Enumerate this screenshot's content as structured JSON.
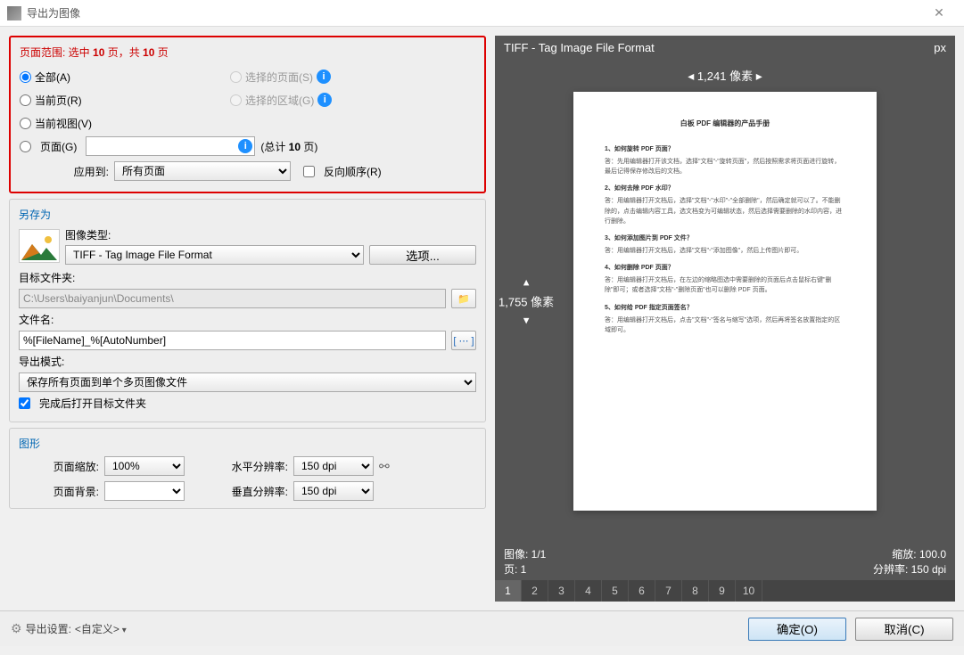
{
  "window": {
    "title": "导出为图像"
  },
  "pageRange": {
    "title_prefix": "页面范围: 选中 ",
    "selected": "10",
    "title_mid": " 页，共 ",
    "total": "10",
    "title_suffix": " 页",
    "all": "全部(A)",
    "current": "当前页(R)",
    "currentView": "当前视图(V)",
    "pages": "页面(G)",
    "selectedPages": "选择的页面(S)",
    "selectedArea": "选择的区域(G)",
    "totalLabel_prefix": "(总计 ",
    "totalLabel_count": "10",
    "totalLabel_suffix": " 页)",
    "applyTo": "应用到:",
    "applyToValue": "所有页面",
    "reverse": "反向顺序(R)"
  },
  "saveAs": {
    "title": "另存为",
    "imageType": "图像类型:",
    "imageTypeValue": "TIFF - Tag Image File Format",
    "options": "选项...",
    "targetFolder": "目标文件夹:",
    "targetFolderValue": "C:\\Users\\baiyanjun\\Documents\\",
    "fileName": "文件名:",
    "fileNameValue": "%[FileName]_%[AutoNumber]",
    "exportMode": "导出模式:",
    "exportModeValue": "保存所有页面到单个多页图像文件",
    "openAfter": "完成后打开目标文件夹"
  },
  "graphics": {
    "title": "图形",
    "pageZoom": "页面缩放:",
    "pageZoomValue": "100%",
    "pageBg": "页面背景:",
    "hRes": "水平分辨率:",
    "hResValue": "150 dpi",
    "vRes": "垂直分辨率:",
    "vResValue": "150 dpi"
  },
  "preview": {
    "format": "TIFF - Tag Image File Format",
    "unit": "px",
    "width": "1,241 像素",
    "height": "1,755 像素",
    "imageIdx": "图像: 1/1",
    "pageIdx": "页: 1",
    "zoom": "缩放: 100.0",
    "res": "分辨率: 150 dpi",
    "tabs": [
      "1",
      "2",
      "3",
      "4",
      "5",
      "6",
      "7",
      "8",
      "9",
      "10"
    ],
    "doc": {
      "title": "白板 PDF 编辑器的产品手册",
      "q1": "1、如何旋转 PDF 页面？",
      "a1": "答：先用编辑器打开该文档，选择\"文档\"-\"旋转页面\"，然后按照需求将页面进行旋转，最后记得保存修改后的文档。",
      "q2": "2、如何去除 PDF 水印？",
      "a2": "答：用编辑器打开文档后，选择\"文档\"-\"水印\"-\"全部删除\"，然后确定就可以了。不能删除的，点击编辑内容工具，选文档变为可编辑状态，然后选择需要删除的水印内容，进行删除。",
      "q3": "3、如何添加图片到 PDF 文件？",
      "a3": "答：用编辑器打开文档后，选择\"文档\"-\"添加图像\"，然后上传图片即可。",
      "q4": "4、如何删除 PDF 页面？",
      "a4": "答：用编辑器打开文档后，在左边的缩略图选中需要删除的页面后点击鼠标右键\"删除\"即可；或者选择\"文档\"-\"删除页面\"也可以删除 PDF 页面。",
      "q5": "5、如何给 PDF 指定页面签名？",
      "a5": "答：用编辑器打开文档后，点击\"文档\"-\"签名与缩写\"选项，然后再将签名放置指定的区域即可。"
    }
  },
  "bottom": {
    "settingsLabel": "导出设置:",
    "settingsValue": "<自定义>",
    "ok": "确定(O)",
    "cancel": "取消(C)"
  }
}
